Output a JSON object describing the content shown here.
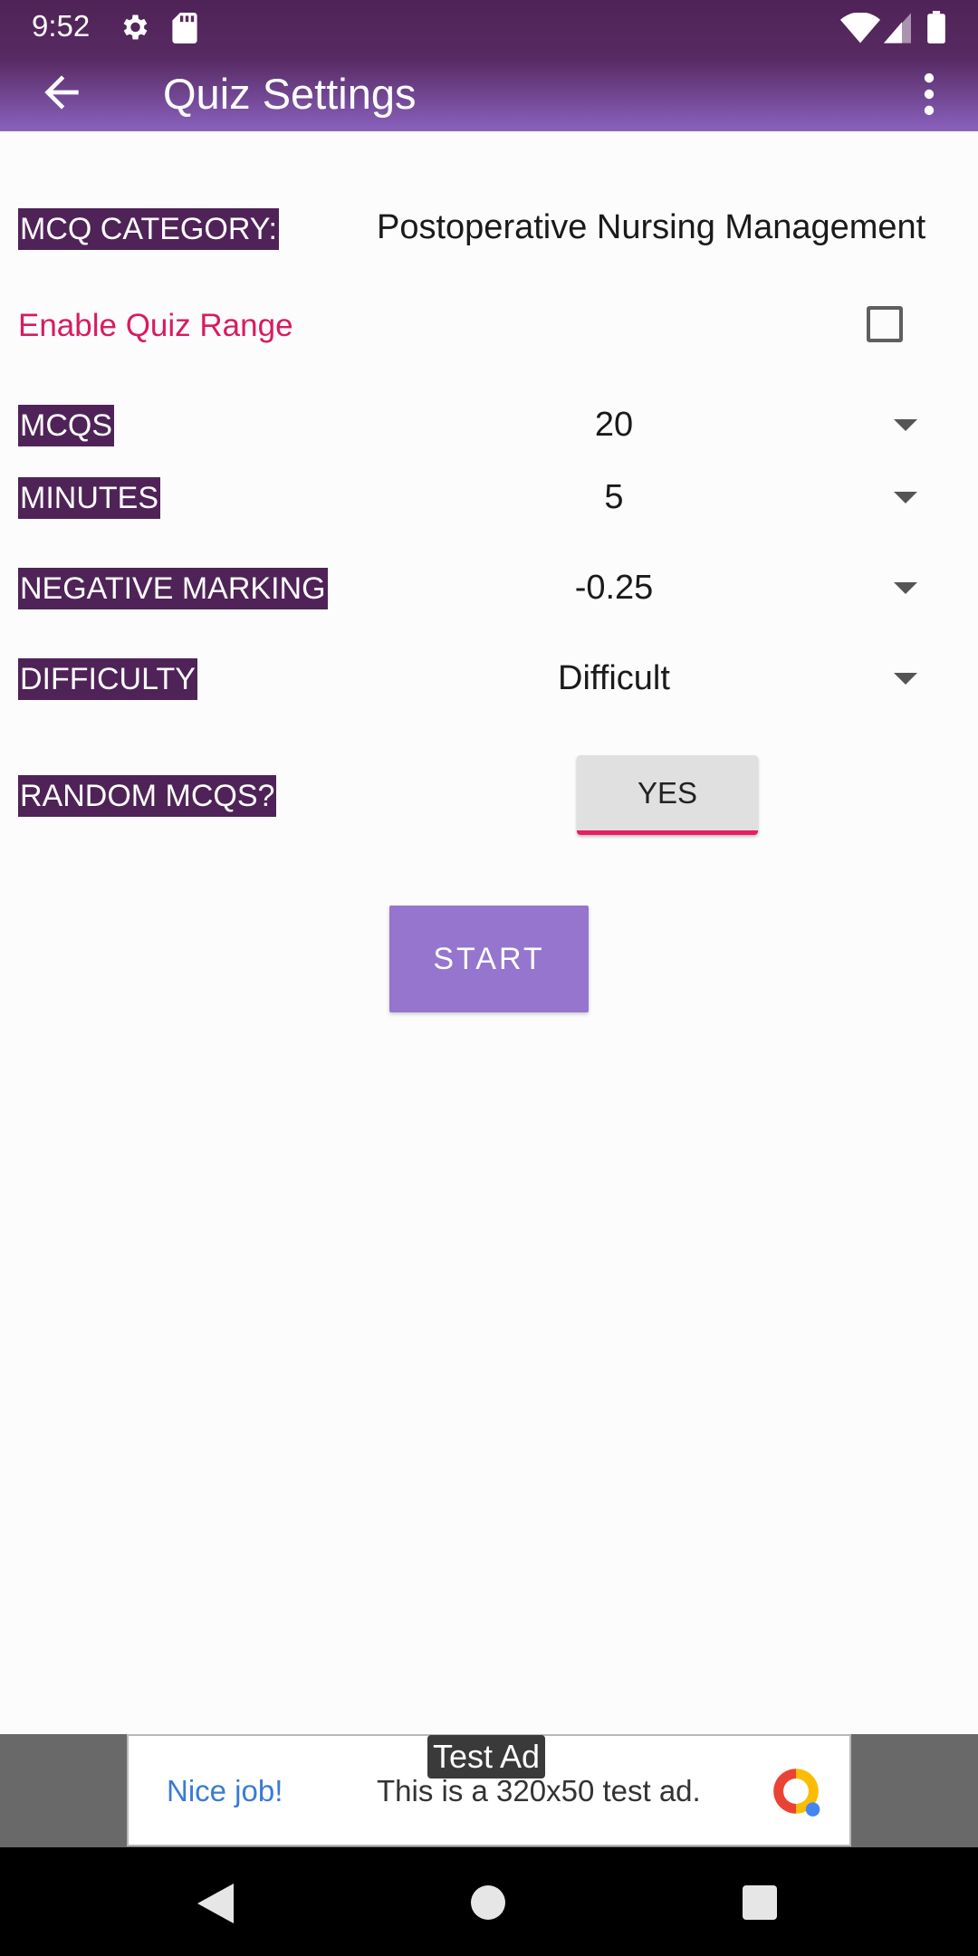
{
  "status_bar": {
    "time": "9:52"
  },
  "toolbar": {
    "title": "Quiz Settings"
  },
  "settings": {
    "category_label": "MCQ CATEGORY:",
    "category_value": "Postoperative Nursing Management",
    "range_label": "Enable Quiz Range",
    "range_checked": false,
    "mcqs_label": "MCQS",
    "mcqs_value": "20",
    "minutes_label": "MINUTES",
    "minutes_value": "5",
    "negative_label": "NEGATIVE MARKING",
    "negative_value": "-0.25",
    "difficulty_label": "DIFFICULTY",
    "difficulty_value": "Difficult",
    "random_label": "RANDOM MCQS?",
    "random_value": "YES",
    "start_label": "START"
  },
  "ad": {
    "badge": "Test Ad",
    "headline": "Nice job!",
    "body": "This is a 320x50 test ad."
  },
  "colors": {
    "primary_dark": "#4f2357",
    "accent": "#e91e63",
    "range_text": "#d81b60",
    "start_button": "#9575cd"
  }
}
